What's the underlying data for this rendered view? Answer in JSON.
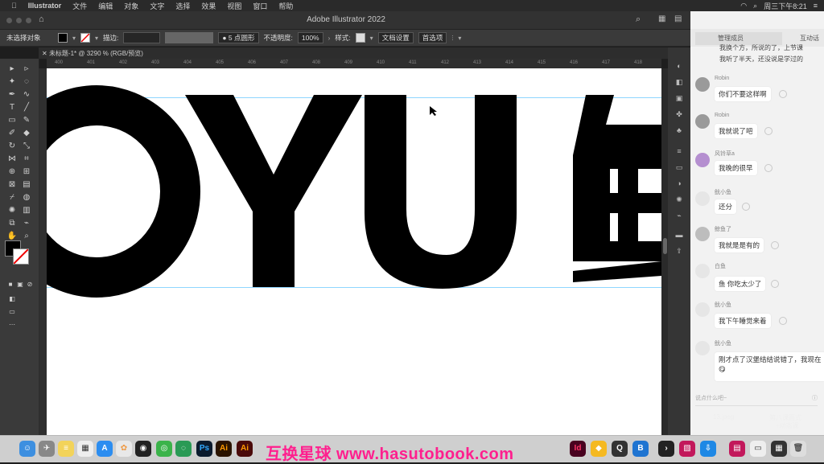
{
  "menubar": {
    "app": "Illustrator",
    "items": [
      "文件",
      "编辑",
      "对象",
      "文字",
      "选择",
      "效果",
      "视图",
      "窗口",
      "帮助"
    ],
    "clock": "周三下午8:21"
  },
  "window": {
    "title": "Adobe Illustrator 2022"
  },
  "controlbar": {
    "selection_label": "未选择对象",
    "opacity_label": "描边:",
    "stroke_profile": "5 点圆形",
    "opacity_text": "不透明度:",
    "opacity_value": "100%",
    "style_label": "样式:",
    "doc_settings": "文档设置",
    "preferences": "首选项"
  },
  "doc_tab": {
    "label": "未标题-1* @ 3290 % (RGB/预览)"
  },
  "ruler_ticks": [
    "400",
    "401",
    "402",
    "403",
    "404",
    "405",
    "406",
    "407",
    "408",
    "409",
    "410",
    "411",
    "412",
    "413",
    "414",
    "415",
    "416",
    "417",
    "418"
  ],
  "canvas": {
    "letters": "OYU",
    "cjk_fragment": "鱼"
  },
  "chat": {
    "tab1": "管理成员",
    "tab2": "互动话",
    "intro_line1": "我换个方，所说的了，上节课",
    "intro_line2": "我听了半天，还没说是学过的",
    "messages": [
      {
        "user": "Robin",
        "text": "你们不要这样啊"
      },
      {
        "user": "Robin",
        "text": "我就说了吧"
      },
      {
        "user": "风铃草a",
        "text": "我晚的很早"
      },
      {
        "user": "鱿小鱼",
        "text": "还分"
      },
      {
        "user": "鲸鱼了",
        "text": "我就是是有的"
      },
      {
        "user": "白鱼",
        "text": "鱼 你吃太少了"
      },
      {
        "user": "鱿小鱼",
        "text": "我下午睡觉来着"
      },
      {
        "user": "鱿小鱼",
        "text": "刚才点了汉堡结结说错了，我现在"
      }
    ],
    "input_placeholder": "说点什么吧~"
  },
  "notification": {
    "file": "13.jpeg",
    "line2": "第八课面式",
    "line3": "+动态课"
  },
  "dock": {
    "watermark": "互换星球 www.hasutobook.com",
    "apps": [
      "Ps",
      "Ai",
      "Ai",
      "Id"
    ]
  },
  "colors": {
    "accent": "#ff1f8e",
    "guide": "#8fd6ff",
    "canvas": "#ffffff"
  }
}
